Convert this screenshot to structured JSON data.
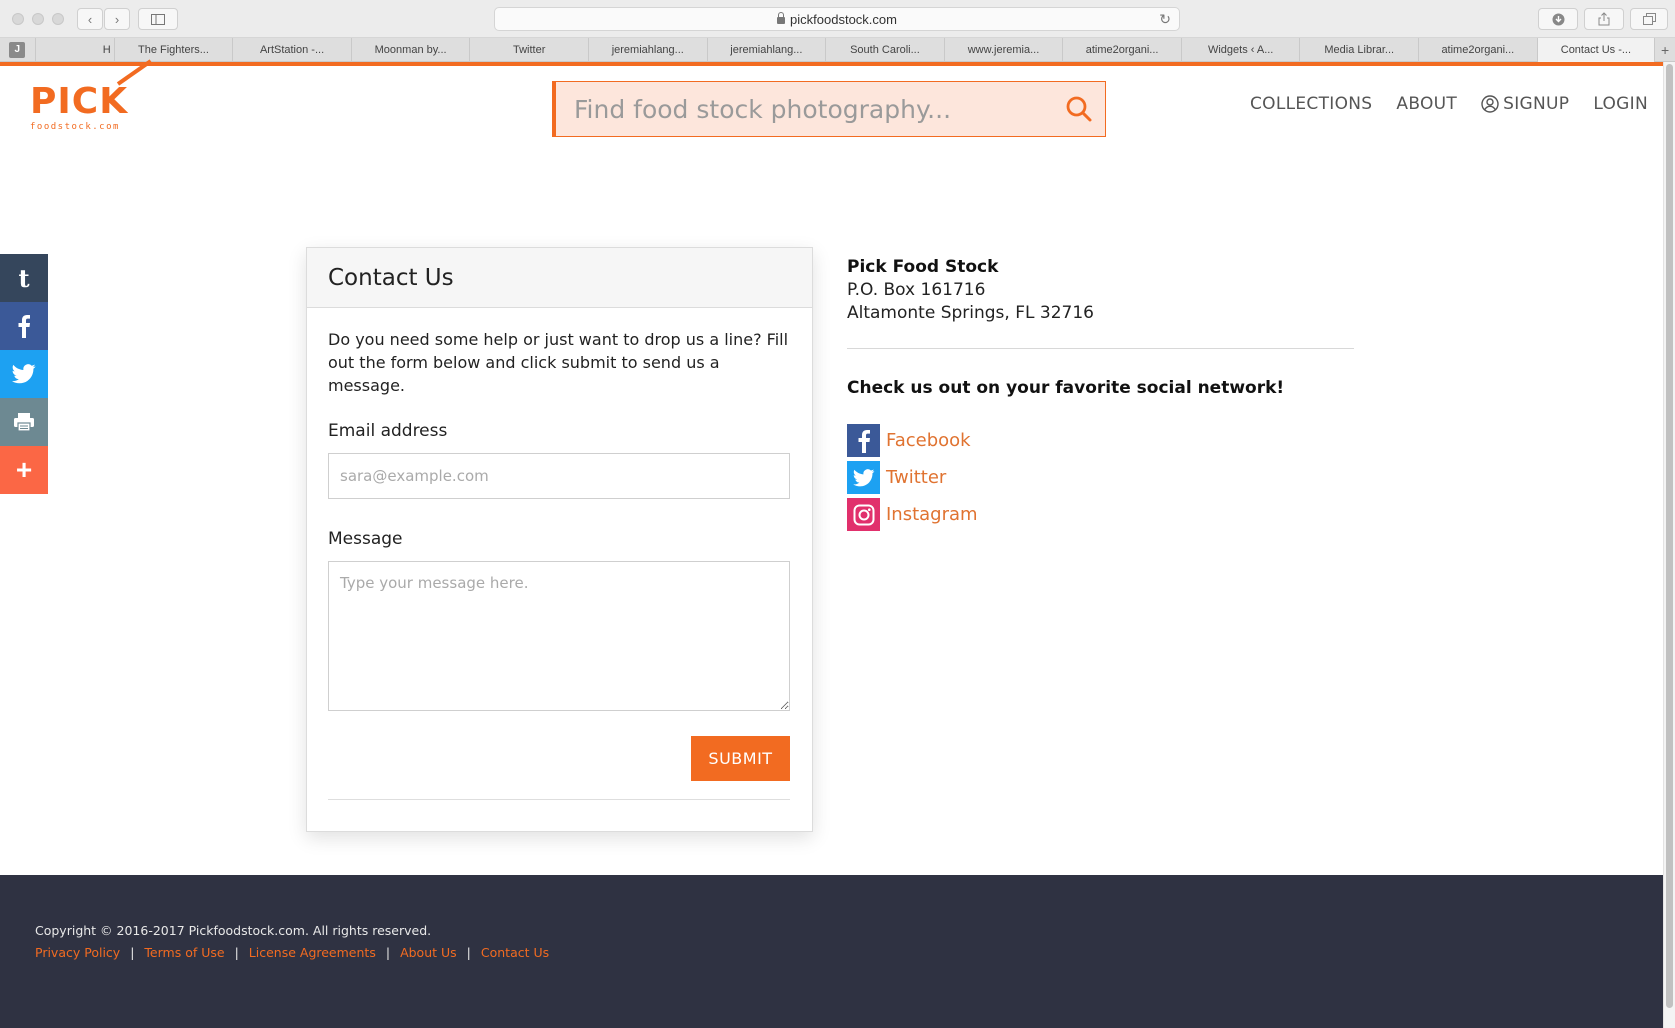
{
  "browser": {
    "url": "pickfoodstock.com",
    "tabs": [
      {
        "label": "J",
        "type": "pinned"
      },
      {
        "label": "H",
        "width": 80
      },
      {
        "label": "The Fighters..."
      },
      {
        "label": "ArtStation -..."
      },
      {
        "label": "Moonman by..."
      },
      {
        "label": "Twitter"
      },
      {
        "label": "jeremiahlang..."
      },
      {
        "label": "jeremiahlang..."
      },
      {
        "label": "South Caroli..."
      },
      {
        "label": "www.jeremia..."
      },
      {
        "label": "atime2organi..."
      },
      {
        "label": "Widgets ‹ A..."
      },
      {
        "label": "Media Librar..."
      },
      {
        "label": "atime2organi..."
      },
      {
        "label": "Contact Us -...",
        "active": true
      }
    ]
  },
  "header": {
    "logo_text": "PICK",
    "logo_sub": "foodstock.com",
    "search_placeholder": "Find food stock photography...",
    "nav": {
      "collections": "COLLECTIONS",
      "about": "ABOUT",
      "signup": "SIGNUP",
      "login": "LOGIN"
    }
  },
  "share_rail": [
    "tumblr-icon",
    "facebook-icon",
    "twitter-icon",
    "print-icon",
    "plus-icon"
  ],
  "contact_card": {
    "title": "Contact Us",
    "intro": "Do you need some help or just want to drop us a line? Fill out the form below and click submit to send us a message.",
    "email_label": "Email address",
    "email_placeholder": "sara@example.com",
    "message_label": "Message",
    "message_placeholder": "Type your message here.",
    "submit_label": "SUBMIT"
  },
  "info": {
    "company": "Pick Food Stock",
    "address_line1": "P.O. Box 161716",
    "address_line2": "Altamonte Springs, FL 32716",
    "social_heading": "Check us out on your favorite social network!",
    "social": {
      "facebook": "Facebook",
      "twitter": "Twitter",
      "instagram": "Instagram"
    }
  },
  "footer": {
    "copyright": "Copyright © 2016-2017 Pickfoodstock.com. All rights reserved.",
    "links": {
      "privacy": "Privacy Policy",
      "terms": "Terms of Use",
      "license": "License Agreements",
      "about": "About Us",
      "contact": "Contact Us"
    },
    "separator": "|"
  },
  "colors": {
    "brand_orange": "#f26b21",
    "footer_bg": "#2f3242",
    "link_orange": "#e07331"
  }
}
